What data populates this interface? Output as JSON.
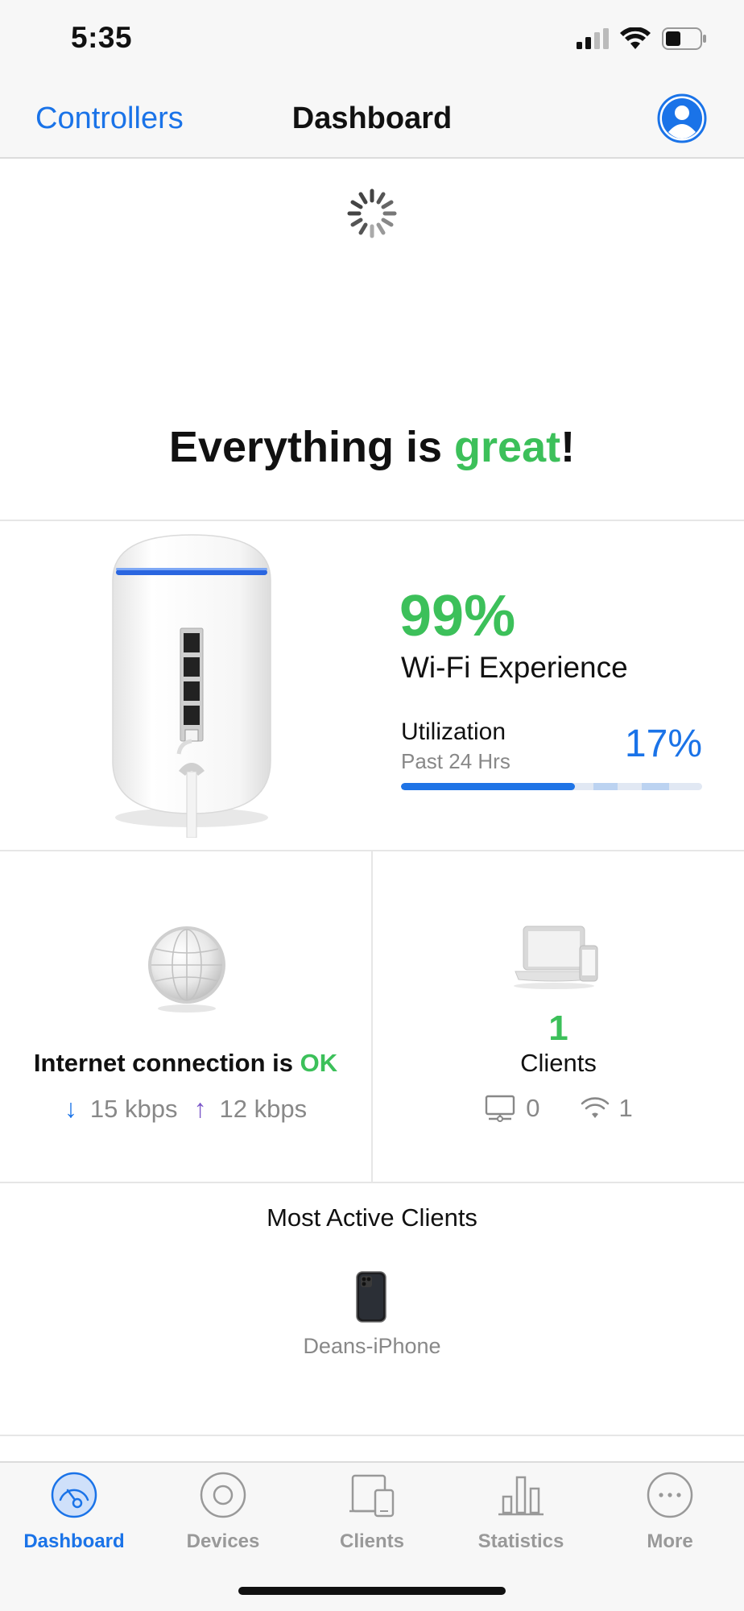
{
  "status_bar": {
    "time": "5:35"
  },
  "nav": {
    "back_label": "Controllers",
    "title": "Dashboard"
  },
  "headline": {
    "prefix": "Everything is ",
    "accent": "great",
    "suffix": "!"
  },
  "device": {
    "wifi_experience_value": "99%",
    "wifi_experience_label": "Wi-Fi Experience",
    "utilization_label": "Utilization",
    "utilization_period": "Past 24 Hrs",
    "utilization_value": "17%",
    "utilization_fraction": 0.17
  },
  "internet": {
    "label_prefix": "Internet connection is ",
    "status": "OK",
    "download": "15 kbps",
    "upload": "12 kbps"
  },
  "clients": {
    "count": "1",
    "label": "Clients",
    "wired_count": "0",
    "wireless_count": "1"
  },
  "most_active": {
    "title": "Most Active Clients",
    "items": [
      {
        "name": "Deans-iPhone"
      }
    ]
  },
  "tabs": [
    {
      "label": "Dashboard",
      "icon": "dashboard-icon",
      "active": true
    },
    {
      "label": "Devices",
      "icon": "devices-icon",
      "active": false
    },
    {
      "label": "Clients",
      "icon": "clients-icon",
      "active": false
    },
    {
      "label": "Statistics",
      "icon": "statistics-icon",
      "active": false
    },
    {
      "label": "More",
      "icon": "more-icon",
      "active": false
    }
  ],
  "colors": {
    "accent_blue": "#1a73e8",
    "success_green": "#3cc05a",
    "upload_purple": "#7a55c8"
  }
}
